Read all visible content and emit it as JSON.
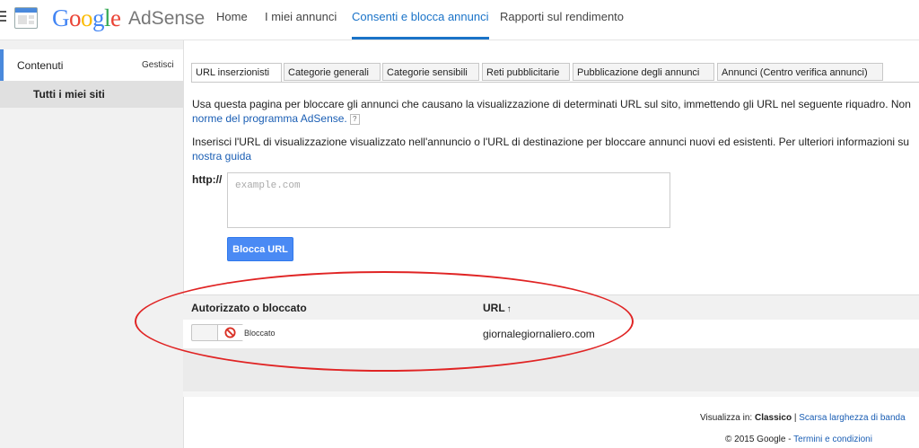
{
  "header": {
    "logo_google": "Google",
    "logo_product": "AdSense",
    "nav": [
      "Home",
      "I miei annunci",
      "Consenti e blocca annunci",
      "Rapporti sul rendimento"
    ],
    "active_nav": "Consenti e blocca annunci"
  },
  "sidebar": {
    "section_label": "Contenuti",
    "manage_label": "Gestisci",
    "item_label": "Tutti i miei siti"
  },
  "tabs": [
    "URL inserzionisti",
    "Categorie generali",
    "Categorie sensibili",
    "Reti pubblicitarie",
    "Pubblicazione degli annunci",
    "Annunci (Centro verifica annunci)"
  ],
  "active_tab": "URL inserzionisti",
  "content": {
    "para1_line1": "Usa questa pagina per bloccare gli annunci che causano la visualizzazione di determinati URL sul sito, immettendo gli URL nel seguente riquadro. Non",
    "para1_link": "norme del programma AdSense.",
    "para2_line1": "Inserisci l'URL di visualizzazione visualizzato nell'annuncio o l'URL di destinazione per bloccare annunci nuovi ed esistenti. Per ulteriori informazioni su",
    "para2_link": "nostra guida",
    "http_label": "http://",
    "url_placeholder": "example.com",
    "block_button": "Blocca URL"
  },
  "table": {
    "col1": "Autorizzato o bloccato",
    "col2": "URL",
    "rows": [
      {
        "status": "Bloccato",
        "url": "giornalegiornaliero.com"
      }
    ]
  },
  "footer": {
    "view_in": "Visualizza in:",
    "classic": "Classico",
    "low_bw": "Scarsa larghezza di banda",
    "copyright": "© 2015 Google",
    "terms": "Termini e condizioni"
  },
  "colors": {
    "accent": "#1a73c8",
    "button": "#4a8af4",
    "annotation": "#e02424"
  }
}
